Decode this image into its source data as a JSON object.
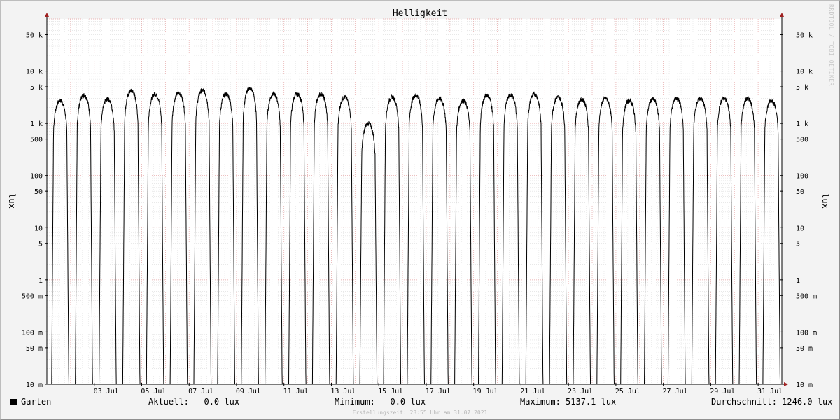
{
  "chart_data": {
    "type": "line",
    "title": "Helligkeit",
    "ylabel": "lux",
    "ylabel_right": "lux",
    "yscale": "log",
    "ylim": [
      0.01,
      100000
    ],
    "grid": true,
    "ytick_values": [
      0.01,
      0.05,
      0.1,
      0.5,
      1,
      5,
      10,
      50,
      100,
      500,
      1000,
      5000,
      10000,
      50000
    ],
    "ytick_labels": [
      "10 m",
      "50 m",
      "100 m",
      "500 m",
      "1",
      "5",
      "10",
      "50",
      "100",
      "500",
      "1 k",
      "5 k",
      "10 k",
      "50 k"
    ],
    "xlim": [
      "2021-07-01 00:00",
      "2021-08-01 00:00"
    ],
    "x_ticks": [
      {
        "day": 3,
        "label": "03 Jul"
      },
      {
        "day": 5,
        "label": "05 Jul"
      },
      {
        "day": 7,
        "label": "07 Jul"
      },
      {
        "day": 9,
        "label": "09 Jul"
      },
      {
        "day": 11,
        "label": "11 Jul"
      },
      {
        "day": 13,
        "label": "13 Jul"
      },
      {
        "day": 15,
        "label": "15 Jul"
      },
      {
        "day": 17,
        "label": "17 Jul"
      },
      {
        "day": 19,
        "label": "19 Jul"
      },
      {
        "day": 21,
        "label": "21 Jul"
      },
      {
        "day": 23,
        "label": "23 Jul"
      },
      {
        "day": 25,
        "label": "25 Jul"
      },
      {
        "day": 27,
        "label": "27 Jul"
      },
      {
        "day": 29,
        "label": "29 Jul"
      },
      {
        "day": 31,
        "label": "31 Jul"
      }
    ],
    "series": [
      {
        "name": "Garten",
        "color": "#000000",
        "daily": [
          {
            "date": "2021-07-01",
            "peak_lux": 3000
          },
          {
            "date": "2021-07-02",
            "peak_lux": 3800
          },
          {
            "date": "2021-07-03",
            "peak_lux": 3200
          },
          {
            "date": "2021-07-04",
            "peak_lux": 4600
          },
          {
            "date": "2021-07-05",
            "peak_lux": 4000
          },
          {
            "date": "2021-07-06",
            "peak_lux": 4200
          },
          {
            "date": "2021-07-07",
            "peak_lux": 4700
          },
          {
            "date": "2021-07-08",
            "peak_lux": 4000
          },
          {
            "date": "2021-07-09",
            "peak_lux": 5137
          },
          {
            "date": "2021-07-10",
            "peak_lux": 4000
          },
          {
            "date": "2021-07-11",
            "peak_lux": 4000
          },
          {
            "date": "2021-07-12",
            "peak_lux": 4000
          },
          {
            "date": "2021-07-13",
            "peak_lux": 3500
          },
          {
            "date": "2021-07-14",
            "peak_lux": 1100
          },
          {
            "date": "2021-07-15",
            "peak_lux": 3500
          },
          {
            "date": "2021-07-16",
            "peak_lux": 3800
          },
          {
            "date": "2021-07-17",
            "peak_lux": 3300
          },
          {
            "date": "2021-07-18",
            "peak_lux": 3000
          },
          {
            "date": "2021-07-19",
            "peak_lux": 3800
          },
          {
            "date": "2021-07-20",
            "peak_lux": 3800
          },
          {
            "date": "2021-07-21",
            "peak_lux": 4000
          },
          {
            "date": "2021-07-22",
            "peak_lux": 3500
          },
          {
            "date": "2021-07-23",
            "peak_lux": 3200
          },
          {
            "date": "2021-07-24",
            "peak_lux": 3300
          },
          {
            "date": "2021-07-25",
            "peak_lux": 3000
          },
          {
            "date": "2021-07-26",
            "peak_lux": 3200
          },
          {
            "date": "2021-07-27",
            "peak_lux": 3300
          },
          {
            "date": "2021-07-28",
            "peak_lux": 3300
          },
          {
            "date": "2021-07-29",
            "peak_lux": 3300
          },
          {
            "date": "2021-07-30",
            "peak_lux": 3300
          },
          {
            "date": "2021-07-31",
            "peak_lux": 3000
          }
        ]
      }
    ]
  },
  "legend": {
    "series_label": "Garten",
    "current": "Aktuell:   0.0 lux",
    "minimum": "Minimum:   0.0 lux",
    "maximum": "Maximum: 5137.1 lux",
    "average": "Durchschnitt: 1246.0 lux"
  },
  "footer": "Erstellungszeit: 23:55 Uhr am 31.07.2021",
  "watermark": "RRDTOOL / TOBI OETIKER"
}
